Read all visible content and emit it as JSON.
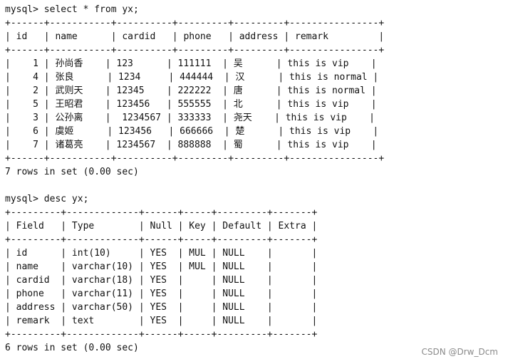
{
  "terminal": {
    "lines": [
      "mysql> select * from yx;",
      "+------+-----------+----------+---------+---------+----------------+",
      "| id   | name      | cardid   | phone   | address | remark         |",
      "+------+-----------+----------+---------+---------+----------------+",
      "|    1 | 孙尚香    | 123      | 111111  | 吴      | this is vip    |",
      "|    4 | 张良      | 1234     | 444444  | 汉      | this is normal |",
      "|    2 | 武则天    | 12345    | 222222  | 唐      | this is normal |",
      "|    5 | 王昭君    | 123456   | 555555  | 北      | this is vip    |",
      "|    3 | 公孙离    |  1234567 | 333333  | 尧天    | this is vip    |",
      "|    6 | 虞姬      | 123456   | 666666  | 楚      | this is vip    |",
      "|    7 | 诸葛亮    | 1234567  | 888888  | 蜀      | this is vip    |",
      "+------+-----------+----------+---------+---------+----------------+",
      "7 rows in set (0.00 sec)",
      "",
      "mysql> desc yx;",
      "+---------+-------------+------+-----+---------+-------+",
      "| Field   | Type        | Null | Key | Default | Extra |",
      "+---------+-------------+------+-----+---------+-------+",
      "| id      | int(10)     | YES  | MUL | NULL    |       |",
      "| name    | varchar(10) | YES  | MUL | NULL    |       |",
      "| cardid  | varchar(18) | YES  |     | NULL    |       |",
      "| phone   | varchar(11) | YES  |     | NULL    |       |",
      "| address | varchar(50) | YES  |     | NULL    |       |",
      "| remark  | text        | YES  |     | NULL    |       |",
      "+---------+-------------+------+-----+---------+-------+",
      "6 rows in set (0.00 sec)"
    ]
  },
  "watermark": "CSDN @Drw_Dcm"
}
